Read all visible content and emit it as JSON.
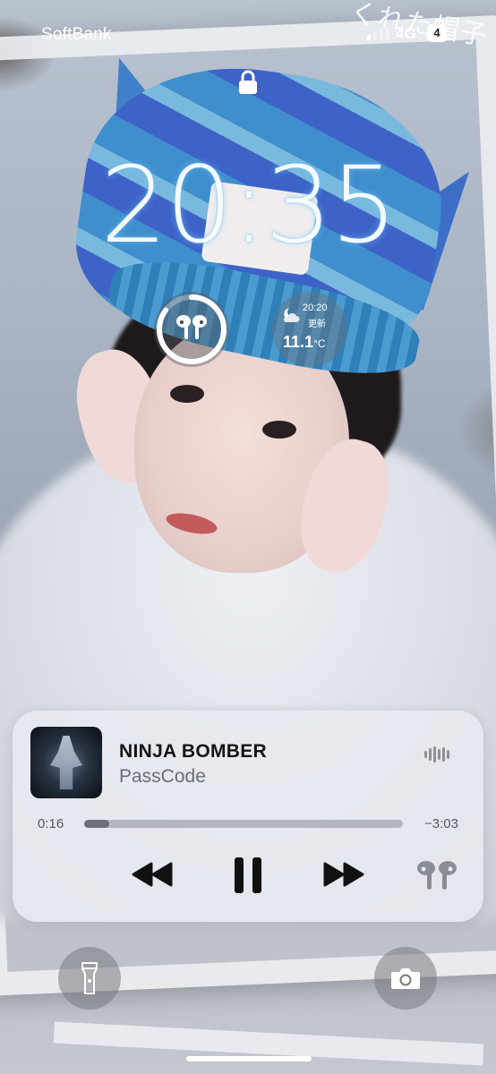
{
  "status_bar": {
    "carrier": "SoftBank",
    "network": "4G",
    "battery_level": "4"
  },
  "lock_screen": {
    "lock_icon": "lock-icon",
    "time": "20:35"
  },
  "widgets": {
    "airpods_battery": {
      "icon": "airpods-icon",
      "level": 0.85
    },
    "weather": {
      "icon": "partly-cloudy-night-icon",
      "updated_time": "20:20",
      "updated_label": "更新",
      "temperature": "11.1",
      "unit": "°C"
    }
  },
  "wallpaper": {
    "handwriting": "くれた帽子"
  },
  "now_playing": {
    "title": "NINJA BOMBER",
    "artist": "PassCode",
    "elapsed": "0:16",
    "remaining": "−3:03",
    "progress": 0.08,
    "controls": {
      "rewind_icon": "rewind-icon",
      "pause_icon": "pause-icon",
      "forward_icon": "fast-forward-icon",
      "output_icon": "airpods-icon",
      "waveform_icon": "waveform-icon"
    }
  },
  "quick_actions": {
    "flashlight_icon": "flashlight-icon",
    "camera_icon": "camera-icon"
  },
  "colors": {
    "clock_glow": "#78c8ff",
    "card_background": "#e8eaf0",
    "title_text": "#141414",
    "artist_text": "#6a6d73"
  }
}
